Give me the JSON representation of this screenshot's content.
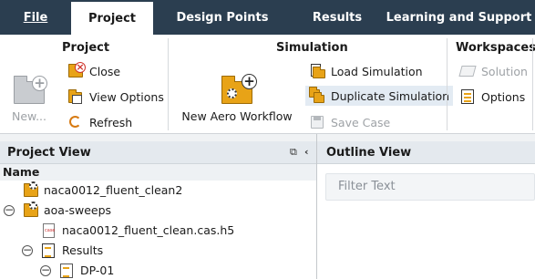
{
  "tabs": [
    {
      "label": "File"
    },
    {
      "label": "Project"
    },
    {
      "label": "Design Points"
    },
    {
      "label": "Results"
    },
    {
      "label": "Learning and Support"
    }
  ],
  "active_tab": "Project",
  "ribbon": {
    "project": {
      "title": "Project",
      "new_label": "New...",
      "close_label": "Close",
      "view_options_label": "View Options",
      "refresh_label": "Refresh"
    },
    "simulation": {
      "title": "Simulation",
      "new_aero_label": "New Aero Workflow",
      "load_label": "Load Simulation",
      "duplicate_label": "Duplicate Simulation",
      "save_label": "Save Case"
    },
    "workspaces": {
      "title": "Workspaces",
      "solution_label": "Solution",
      "options_label": "Options"
    }
  },
  "project_view": {
    "title": "Project View",
    "column_header": "Name",
    "rows": [
      {
        "label": "naca0012_fluent_clean2"
      },
      {
        "label": "aoa-sweeps"
      },
      {
        "label": "naca0012_fluent_clean.cas.h5"
      },
      {
        "label": "Results"
      },
      {
        "label": "DP-01"
      }
    ]
  },
  "outline_view": {
    "title": "Outline View",
    "filter_placeholder": "Filter Text"
  },
  "colors": {
    "tab_bar": "#2b3e50",
    "folder": "#e8a317",
    "hover": "#e3ebf3",
    "pane_header": "#e4e9ee"
  }
}
